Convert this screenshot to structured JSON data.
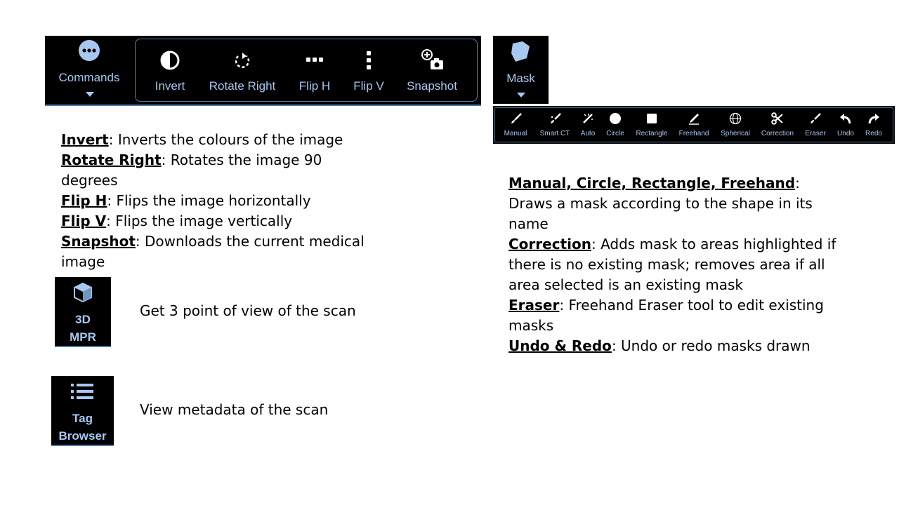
{
  "commands_toolbar": {
    "menu_label": "Commands",
    "items": [
      {
        "label": "Invert",
        "icon": "contrast-icon"
      },
      {
        "label": "Rotate Right",
        "icon": "rotate-right-icon"
      },
      {
        "label": "Flip H",
        "icon": "dots-horizontal-icon"
      },
      {
        "label": "Flip V",
        "icon": "dots-vertical-icon"
      },
      {
        "label": "Snapshot",
        "icon": "camera-plus-icon"
      }
    ]
  },
  "mask_toolbar": {
    "menu_label": "Mask",
    "items": [
      {
        "label": "Manual",
        "icon": "brush-icon"
      },
      {
        "label": "Smart CT",
        "icon": "smart-brush-icon"
      },
      {
        "label": "Auto",
        "icon": "auto-wand-icon"
      },
      {
        "label": "Circle",
        "icon": "circle-icon"
      },
      {
        "label": "Rectangle",
        "icon": "square-icon"
      },
      {
        "label": "Freehand",
        "icon": "pencil-icon"
      },
      {
        "label": "Spherical",
        "icon": "globe-icon"
      },
      {
        "label": "Correction",
        "icon": "scissors-icon"
      },
      {
        "label": "Eraser",
        "icon": "eraser-brush-icon"
      },
      {
        "label": "Undo",
        "icon": "undo-icon"
      },
      {
        "label": "Redo",
        "icon": "redo-icon"
      }
    ]
  },
  "commands_desc": [
    {
      "term": "Invert",
      "text": ": Inverts the colours of the image"
    },
    {
      "term": "Rotate Right",
      "text": ": Rotates the image 90 degrees"
    },
    {
      "term": "Flip H",
      "text": ": Flips the image horizontally"
    },
    {
      "term": "Flip V",
      "text": ": Flips the image vertically"
    },
    {
      "term": "Snapshot",
      "text": ": Downloads the current medical image"
    }
  ],
  "mask_desc": [
    {
      "term": "Manual, Circle, Rectangle, Freehand",
      "text": ": Draws a mask according to the shape in its name"
    },
    {
      "term": "Correction",
      "text": ": Adds mask to areas highlighted if there is no existing mask; removes area if all area selected is an existing mask"
    },
    {
      "term": "Eraser",
      "text": ": Freehand Eraser tool to edit existing masks"
    },
    {
      "term": "Undo & Redo",
      "text": ": Undo or redo masks drawn"
    }
  ],
  "mpr": {
    "line1": "3D",
    "line2": "MPR",
    "caption": "Get 3 point of view of the scan"
  },
  "tag_browser": {
    "line1": "Tag",
    "line2": "Browser",
    "caption": "View metadata of the scan"
  },
  "colors": {
    "toolbar_bg": "#000000",
    "label_blue": "#a7c8f0",
    "border_blue": "#4a78a8"
  }
}
